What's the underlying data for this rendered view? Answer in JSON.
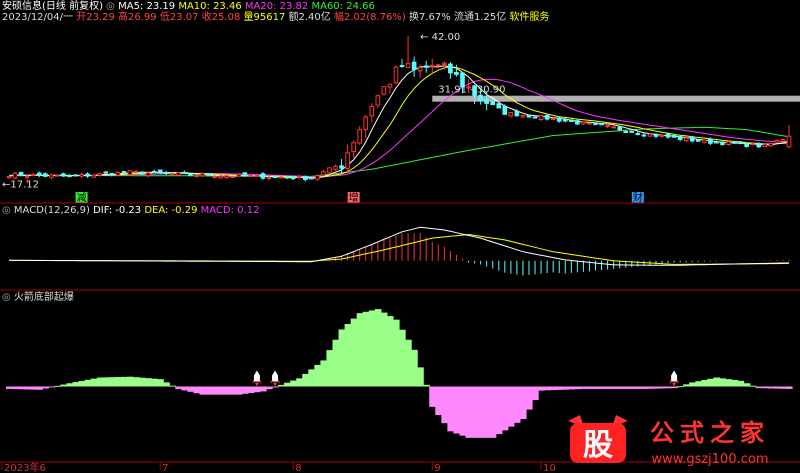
{
  "header": {
    "stock_name": "安硕信息",
    "period": "(日线 前复权)",
    "date": "2023/12/04/一",
    "open_label": "开",
    "open": "23.29",
    "high_label": "高",
    "high": "26.99",
    "low_label": "低",
    "low": "23.07",
    "close_label": "收",
    "close": "25.08",
    "volume_label": "量",
    "volume": "95617",
    "amount_label": "额",
    "amount": "2.40亿",
    "change_label": "幅",
    "change": "2.02(8.76%)",
    "turnover_label": "换",
    "turnover": "7.67%",
    "float_label": "流通",
    "float": "1.25亿",
    "industry": "软件服务"
  },
  "ma_legend": [
    {
      "label": "MA5:",
      "value": "23.19",
      "color": "#ffffff"
    },
    {
      "label": "MA10:",
      "value": "23.46",
      "color": "#ffff00"
    },
    {
      "label": "MA20:",
      "value": "23.82",
      "color": "#ff33ff"
    },
    {
      "label": "MA60:",
      "value": "24.66",
      "color": "#33ee33"
    }
  ],
  "macd_legend": {
    "title": "MACD(12,26,9)",
    "dif_label": "DIF:",
    "dif": "-0.23",
    "dea_label": "DEA:",
    "dea": "-0.29",
    "macd_label": "MACD:",
    "macd": "0.12"
  },
  "indicator_title": "火箭底部起爆",
  "annotations": {
    "high_price": "42.00",
    "low_price": "17.12",
    "range_label": "31.91 - 30.90",
    "marker_a": "减",
    "marker_b": "增",
    "marker_c": "财"
  },
  "x_ticks": [
    "2023年6",
    "7",
    "8",
    "9",
    "10"
  ],
  "watermark": {
    "logo": "股",
    "text": "公式之家",
    "url": "www.gszj100.com"
  },
  "colors": {
    "up": "#ff3333",
    "down": "#54ffff",
    "ma5": "#ffffff",
    "ma10": "#ffff00",
    "ma20": "#ff33ff",
    "ma60": "#33ee33",
    "dif": "#ffffff",
    "dea": "#ffff00",
    "pos_area": "#99ff88",
    "neg_area": "#ff88ff",
    "divider": "#aa0000"
  },
  "chart_data": [
    {
      "type": "candlestick",
      "name": "price",
      "ylim": [
        15,
        44
      ],
      "n": 130,
      "key_points": {
        "high": 42.0,
        "low": 17.12,
        "range_high": 31.91,
        "range_low": 30.9,
        "last_open": 23.29,
        "last_high": 26.99,
        "last_low": 23.07,
        "last_close": 25.08
      },
      "close_profile": [
        [
          0,
          18.6
        ],
        [
          10,
          18.3
        ],
        [
          20,
          19.0
        ],
        [
          30,
          18.6
        ],
        [
          40,
          18.3
        ],
        [
          45,
          18.2
        ],
        [
          50,
          18.0
        ],
        [
          55,
          20.5
        ],
        [
          58,
          26.5
        ],
        [
          60,
          30.5
        ],
        [
          63,
          34.5
        ],
        [
          65,
          37.0
        ],
        [
          67,
          36.0
        ],
        [
          70,
          37.0
        ],
        [
          73,
          36.0
        ],
        [
          75,
          34.0
        ],
        [
          78,
          31.5
        ],
        [
          82,
          29.0
        ],
        [
          88,
          28.3
        ],
        [
          95,
          27.2
        ],
        [
          100,
          26.5
        ],
        [
          105,
          25.5
        ],
        [
          110,
          24.8
        ],
        [
          115,
          24.2
        ],
        [
          120,
          23.8
        ],
        [
          125,
          23.4
        ],
        [
          129,
          25.08
        ]
      ],
      "ma60_profile": [
        [
          0,
          18.5
        ],
        [
          30,
          18.4
        ],
        [
          50,
          18.3
        ],
        [
          60,
          19.5
        ],
        [
          75,
          22.5
        ],
        [
          90,
          25.2
        ],
        [
          105,
          26.3
        ],
        [
          115,
          26.6
        ],
        [
          122,
          26.2
        ],
        [
          129,
          25.0
        ]
      ]
    },
    {
      "type": "macd",
      "name": "MACD(12,26,9)",
      "ylim": [
        -3.0,
        4.5
      ],
      "last": {
        "dif": -0.23,
        "dea": -0.29,
        "macd": 0.12
      },
      "dif_profile": [
        [
          0,
          0.05
        ],
        [
          50,
          -0.1
        ],
        [
          55,
          0.5
        ],
        [
          60,
          1.8
        ],
        [
          65,
          3.2
        ],
        [
          68,
          3.7
        ],
        [
          72,
          3.4
        ],
        [
          78,
          2.5
        ],
        [
          85,
          1.0
        ],
        [
          92,
          0.1
        ],
        [
          100,
          -0.45
        ],
        [
          110,
          -0.5
        ],
        [
          120,
          -0.35
        ],
        [
          129,
          -0.23
        ]
      ],
      "dea_profile": [
        [
          0,
          0.05
        ],
        [
          50,
          -0.05
        ],
        [
          55,
          0.2
        ],
        [
          62,
          1.2
        ],
        [
          70,
          2.5
        ],
        [
          76,
          2.9
        ],
        [
          82,
          2.3
        ],
        [
          90,
          1.0
        ],
        [
          100,
          0.0
        ],
        [
          110,
          -0.4
        ],
        [
          120,
          -0.35
        ],
        [
          129,
          -0.29
        ]
      ]
    },
    {
      "type": "area",
      "name": "火箭底部起爆",
      "ylim": [
        -10,
        10
      ],
      "profile": [
        [
          0,
          -0.3
        ],
        [
          5,
          -0.4
        ],
        [
          10,
          0.4
        ],
        [
          15,
          1.1
        ],
        [
          20,
          1.2
        ],
        [
          25,
          0.9
        ],
        [
          28,
          -0.3
        ],
        [
          32,
          -1.0
        ],
        [
          38,
          -1.0
        ],
        [
          42,
          -0.6
        ],
        [
          45,
          0.2
        ],
        [
          48,
          1.0
        ],
        [
          52,
          3.2
        ],
        [
          55,
          7.0
        ],
        [
          58,
          9.0
        ],
        [
          61,
          9.5
        ],
        [
          64,
          8.2
        ],
        [
          67,
          4.5
        ],
        [
          69,
          0.2
        ],
        [
          70,
          -2.5
        ],
        [
          73,
          -5.5
        ],
        [
          76,
          -6.3
        ],
        [
          80,
          -6.3
        ],
        [
          85,
          -4.0
        ],
        [
          88,
          -0.5
        ],
        [
          95,
          -0.3
        ],
        [
          105,
          -0.3
        ],
        [
          110,
          -0.2
        ],
        [
          113,
          0.5
        ],
        [
          117,
          1.1
        ],
        [
          121,
          0.7
        ],
        [
          124,
          -0.2
        ],
        [
          129,
          -0.3
        ]
      ],
      "rocket_positions": [
        41,
        44,
        110
      ]
    }
  ]
}
